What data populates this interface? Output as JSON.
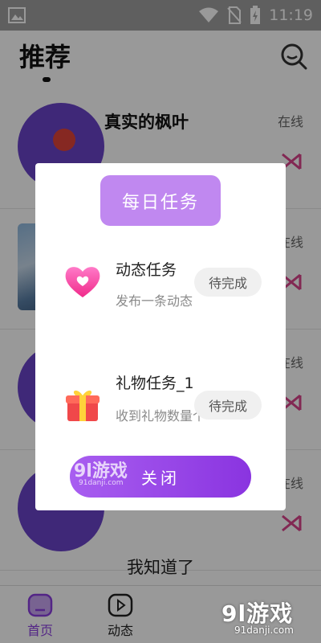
{
  "status_bar": {
    "time": "11:19"
  },
  "header": {
    "title": "推荐"
  },
  "users": [
    {
      "name": "真实的枫叶",
      "status": "在线"
    },
    {
      "name": "",
      "status": "在线"
    },
    {
      "name": "",
      "status": "在线"
    },
    {
      "name": "",
      "status": "在线"
    }
  ],
  "got_it": "我知道了",
  "tabs": [
    {
      "label": "首页",
      "active": true
    },
    {
      "label": "动态",
      "active": false
    }
  ],
  "modal": {
    "title": "每日任务",
    "tasks": [
      {
        "name": "动态任务",
        "desc": "发布一条动态",
        "status": "待完成",
        "icon": "heart-icon"
      },
      {
        "name": "礼物任务_1",
        "desc": "收到礼物数量个",
        "status": "待完成",
        "icon": "gift-icon"
      }
    ],
    "close_label": "关闭"
  },
  "watermark": {
    "main": "9l游戏",
    "sub": "91danji.com",
    "mid_main": "9l游戏",
    "mid_sub": "91danji.com"
  },
  "colors": {
    "accent": "#8b3fe0",
    "title_button": "#c088f0",
    "call_icon": "#d9438a"
  }
}
